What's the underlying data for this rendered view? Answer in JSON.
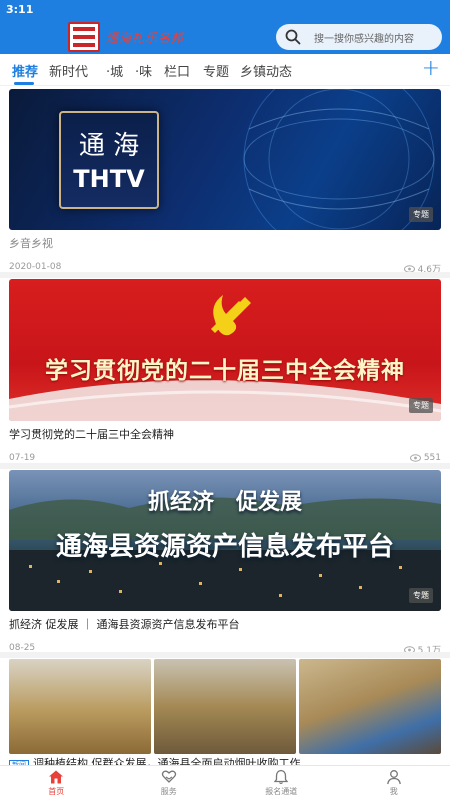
{
  "status": {
    "time": "3:11"
  },
  "header": {
    "brand": "通海礼乐名邦",
    "search_placeholder": "搜一搜你感兴趣的内容"
  },
  "tabs": [
    {
      "label": "推荐",
      "active": true
    },
    {
      "label": "新时代"
    },
    {
      "label": "·城"
    },
    {
      "label": "·味"
    },
    {
      "label": "栏口"
    },
    {
      "label": "专题"
    },
    {
      "label": "乡镇动态"
    }
  ],
  "cards": [
    {
      "image_text": "通 海",
      "image_text2": "THTV",
      "badge": "专题",
      "title": "乡音乡视",
      "date": "2020-01-08",
      "views": "4.6万"
    },
    {
      "image_text": "学习贯彻党的二十届三中全会精神",
      "badge": "专题",
      "title": "学习贯彻党的二十届三中全会精神",
      "date": "07-19",
      "views": "551"
    },
    {
      "image_text": "抓经济　促发展",
      "image_text2": "通海县资源资产信息发布平台",
      "badge": "专题",
      "title": "抓经济 促发展 ｜ 通海县资源资产信息发布平台",
      "date": "08-25",
      "views": "5.1万"
    }
  ],
  "news_item": {
    "tag": "新闻",
    "title": "调种植结构 促群众发展，通海县全面启动烟叶收购工作"
  },
  "bottom_nav": [
    {
      "label": "首页",
      "icon": "home-icon",
      "active": true
    },
    {
      "label": "服务",
      "icon": "heart-hands-icon"
    },
    {
      "label": "报名通道",
      "icon": "bell-icon"
    },
    {
      "label": "我",
      "icon": "user-icon"
    }
  ],
  "colors": {
    "primary": "#1e7fe0",
    "accent": "#e8413a"
  }
}
